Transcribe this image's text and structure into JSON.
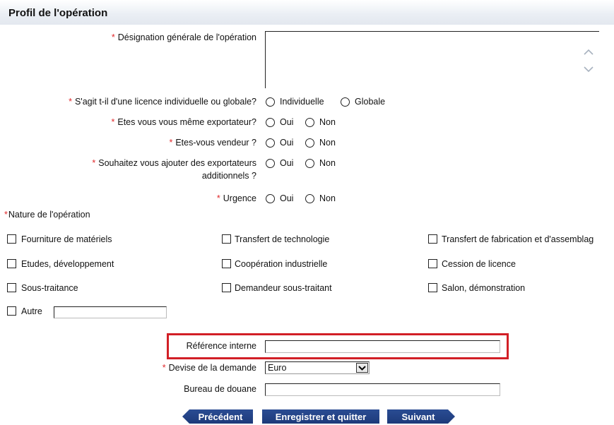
{
  "section": {
    "title": "Profil de l'opération"
  },
  "required_mark": "*",
  "designation": {
    "label": "Désignation générale de l'opération",
    "value": ""
  },
  "licence": {
    "label": "S'agit t-il d'une licence individuelle ou globale?",
    "opt1": "Individuelle",
    "opt2": "Globale"
  },
  "exportateur": {
    "label": "Etes vous vous même exportateur?",
    "opt1": "Oui",
    "opt2": "Non"
  },
  "vendeur": {
    "label": "Etes-vous vendeur ?",
    "opt1": "Oui",
    "opt2": "Non"
  },
  "ajout_export": {
    "label_line1": "Souhaitez vous ajouter des exportateurs",
    "label_line2": "additionnels ?",
    "opt1": "Oui",
    "opt2": "Non"
  },
  "urgence": {
    "label": "Urgence",
    "opt1": "Oui",
    "opt2": "Non"
  },
  "nature": {
    "label": "Nature de l'opération",
    "items": [
      "Fourniture de matériels",
      "Transfert de technologie",
      "Transfert de fabrication et d'assemblag",
      "Etudes, développement",
      "Coopération industrielle",
      "Cession de licence",
      "Sous-traitance",
      "Demandeur sous-traitant",
      "Salon, démonstration"
    ],
    "autre_label": "Autre",
    "autre_value": ""
  },
  "reference": {
    "label": "Référence interne",
    "value": ""
  },
  "devise": {
    "label": "Devise de la demande",
    "value": "Euro"
  },
  "bureau": {
    "label": "Bureau de douane",
    "value": ""
  },
  "buttons": {
    "prev": "Précédent",
    "save": "Enregistrer et quitter",
    "next": "Suivant"
  },
  "colors": {
    "required": "#e0282b",
    "button": "#1f3d80",
    "highlight": "#d21f26"
  }
}
